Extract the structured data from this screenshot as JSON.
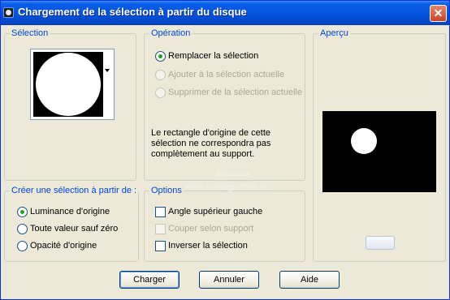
{
  "window": {
    "title": "Chargement de la sélection à partir du disque",
    "close_glyph": "✕"
  },
  "selection": {
    "legend": "Sélection"
  },
  "operation": {
    "legend": "Opération",
    "options": [
      {
        "label": "Remplacer la sélection",
        "checked": true,
        "enabled": true
      },
      {
        "label": "Ajouter à la sélection actuelle",
        "checked": false,
        "enabled": false
      },
      {
        "label": "Supprimer de la sélection actuelle",
        "checked": false,
        "enabled": false
      }
    ],
    "note_line1": "Le rectangle d'origine de cette",
    "note_line2": "sélection ne correspondra pas",
    "note_line3": "complètement au support."
  },
  "preview": {
    "legend": "Aperçu"
  },
  "create_from": {
    "legend": "Créer une sélection à partir de :",
    "options": [
      {
        "label": "Luminance d'origine",
        "checked": true
      },
      {
        "label": "Toute valeur sauf zéro",
        "checked": false
      },
      {
        "label": "Opacité d'origine",
        "checked": false
      }
    ]
  },
  "options": {
    "legend": "Options",
    "items": [
      {
        "label": "Angle supérieur gauche",
        "checked": false,
        "enabled": true
      },
      {
        "label": "Couper selon support",
        "checked": false,
        "enabled": false
      },
      {
        "label": "Inverser la sélection",
        "checked": false,
        "enabled": true
      }
    ]
  },
  "buttons": {
    "ok": "Charger",
    "cancel": "Annuler",
    "help": "Aide"
  },
  "watermark": {
    "line1": "Pinuccia",
    "line2": "www.matdigrafiteo.eu"
  }
}
